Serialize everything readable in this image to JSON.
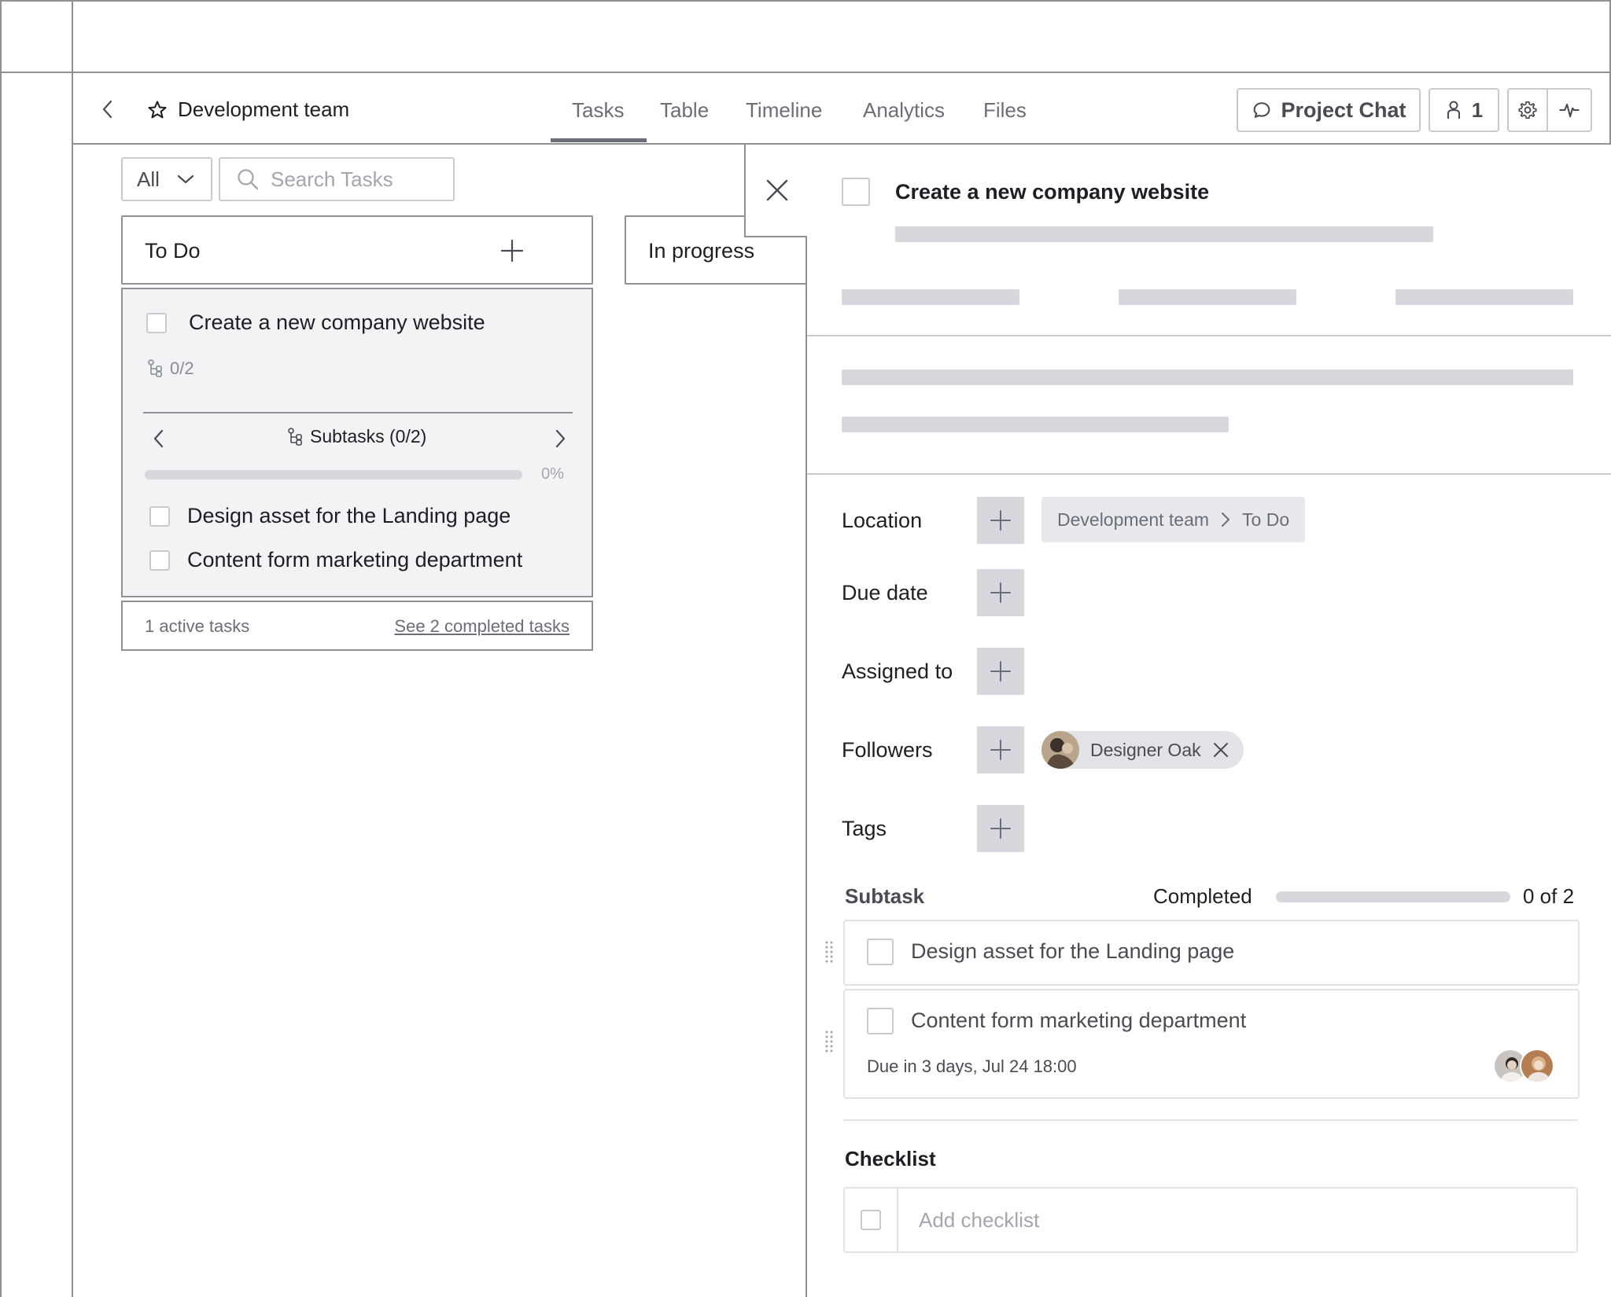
{
  "header": {
    "project_title": "Development team",
    "tabs": [
      {
        "label": "Tasks",
        "active": true
      },
      {
        "label": "Table",
        "active": false
      },
      {
        "label": "Timeline",
        "active": false
      },
      {
        "label": "Analytics",
        "active": false
      },
      {
        "label": "Files",
        "active": false
      }
    ],
    "chat_label": "Project Chat",
    "members_count": "1"
  },
  "toolbar": {
    "filter_value": "All",
    "search_placeholder": "Search Tasks"
  },
  "columns": [
    {
      "title": "To Do"
    },
    {
      "title": "In progress"
    }
  ],
  "task_card": {
    "title": "Create a new company website",
    "subtask_count": "0/2",
    "subtasks_label": "Subtasks (0/2)",
    "progress_pct_label": "0%",
    "progress_fraction": 0,
    "subtasks": [
      "Design asset for the Landing page",
      "Content form marketing department"
    ]
  },
  "column_footer": {
    "active_text": "1 active tasks",
    "completed_link": "See 2 completed tasks"
  },
  "detail": {
    "title": "Create a new company website",
    "properties": {
      "location_label": "Location",
      "location_project": "Development team",
      "location_column": "To Do",
      "due_label": "Due date",
      "assigned_label": "Assigned to",
      "followers_label": "Followers",
      "follower_name": "Designer Oak",
      "tags_label": "Tags"
    },
    "subtask_section": {
      "heading": "Subtask",
      "completed_label": "Completed",
      "completed_count": "0 of 2",
      "completed_fraction": 0,
      "items": [
        {
          "title": "Design asset for the Landing page",
          "due": ""
        },
        {
          "title": "Content form marketing department",
          "due": "Due in 3 days, Jul 24 18:00"
        }
      ]
    },
    "checklist": {
      "heading": "Checklist",
      "placeholder": "Add checklist"
    }
  },
  "colors": {
    "border": "#8f9197",
    "skeleton": "#d6d8dd",
    "muted_text": "#6b6e77"
  }
}
